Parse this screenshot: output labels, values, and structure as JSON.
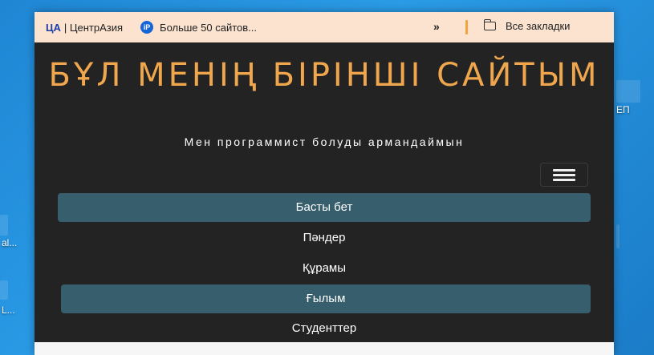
{
  "bookmarks_bar": {
    "items": [
      {
        "logo": "ЦА",
        "label": "ЦентрАзия"
      },
      {
        "icon": "iP",
        "label": "Больше 50 сайтов..."
      }
    ],
    "overflow_label": "»",
    "all_bookmarks_label": "Все закладки"
  },
  "site": {
    "title": "БҰЛ МЕНІҢ БІРІНШІ САЙТЫМ",
    "subtitle": "Мен программист болуды армандаймын",
    "nav": [
      {
        "label": "Басты бет",
        "active": true
      },
      {
        "label": "Пәндер",
        "active": false
      },
      {
        "label": "Құрамы",
        "active": false
      },
      {
        "label": "Ғылым",
        "active": true
      },
      {
        "label": "Студенттер",
        "active": false
      }
    ]
  },
  "desktop": {
    "labels": [
      "ЕП",
      "al...",
      "L..."
    ]
  },
  "colors": {
    "bookmarks_bg": "#fbe3cf",
    "page_bg": "#232323",
    "title": "#f0a64c",
    "nav_active": "#375e6c",
    "desktop": "#1e8ad6"
  }
}
